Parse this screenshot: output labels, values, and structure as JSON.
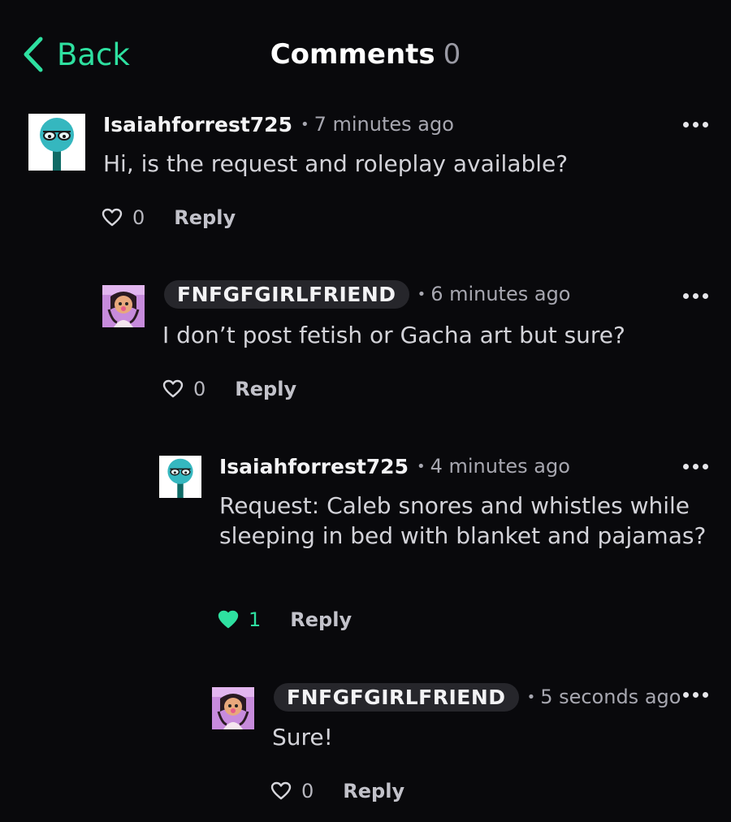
{
  "header": {
    "back_label": "Back",
    "title": "Comments",
    "count": "0"
  },
  "colors": {
    "accent": "#2ee0a0",
    "background": "#09090c"
  },
  "comments": [
    {
      "username": "Isaiahforrest725",
      "time": "7 minutes ago",
      "text": "Hi, is the request and roleplay available?",
      "likes": "0",
      "liked": false,
      "reply_label": "Reply",
      "avatar": "teal-character-avatar"
    },
    {
      "username": "FNFGFGIRLFRIEND",
      "time": "6 minutes ago",
      "text": "I don’t post fetish or Gacha art but sure?",
      "likes": "0",
      "liked": false,
      "reply_label": "Reply",
      "avatar": "purple-girl-avatar"
    },
    {
      "username": "Isaiahforrest725",
      "time": "4 minutes ago",
      "text": "Request: Caleb snores and whistles while sleeping in bed with blanket and pajamas?",
      "likes": "1",
      "liked": true,
      "reply_label": "Reply",
      "avatar": "teal-character-avatar"
    },
    {
      "username": "FNFGFGIRLFRIEND",
      "time": "5 seconds ago",
      "text": "Sure!",
      "likes": "0",
      "liked": false,
      "reply_label": "Reply",
      "avatar": "purple-girl-avatar"
    }
  ]
}
